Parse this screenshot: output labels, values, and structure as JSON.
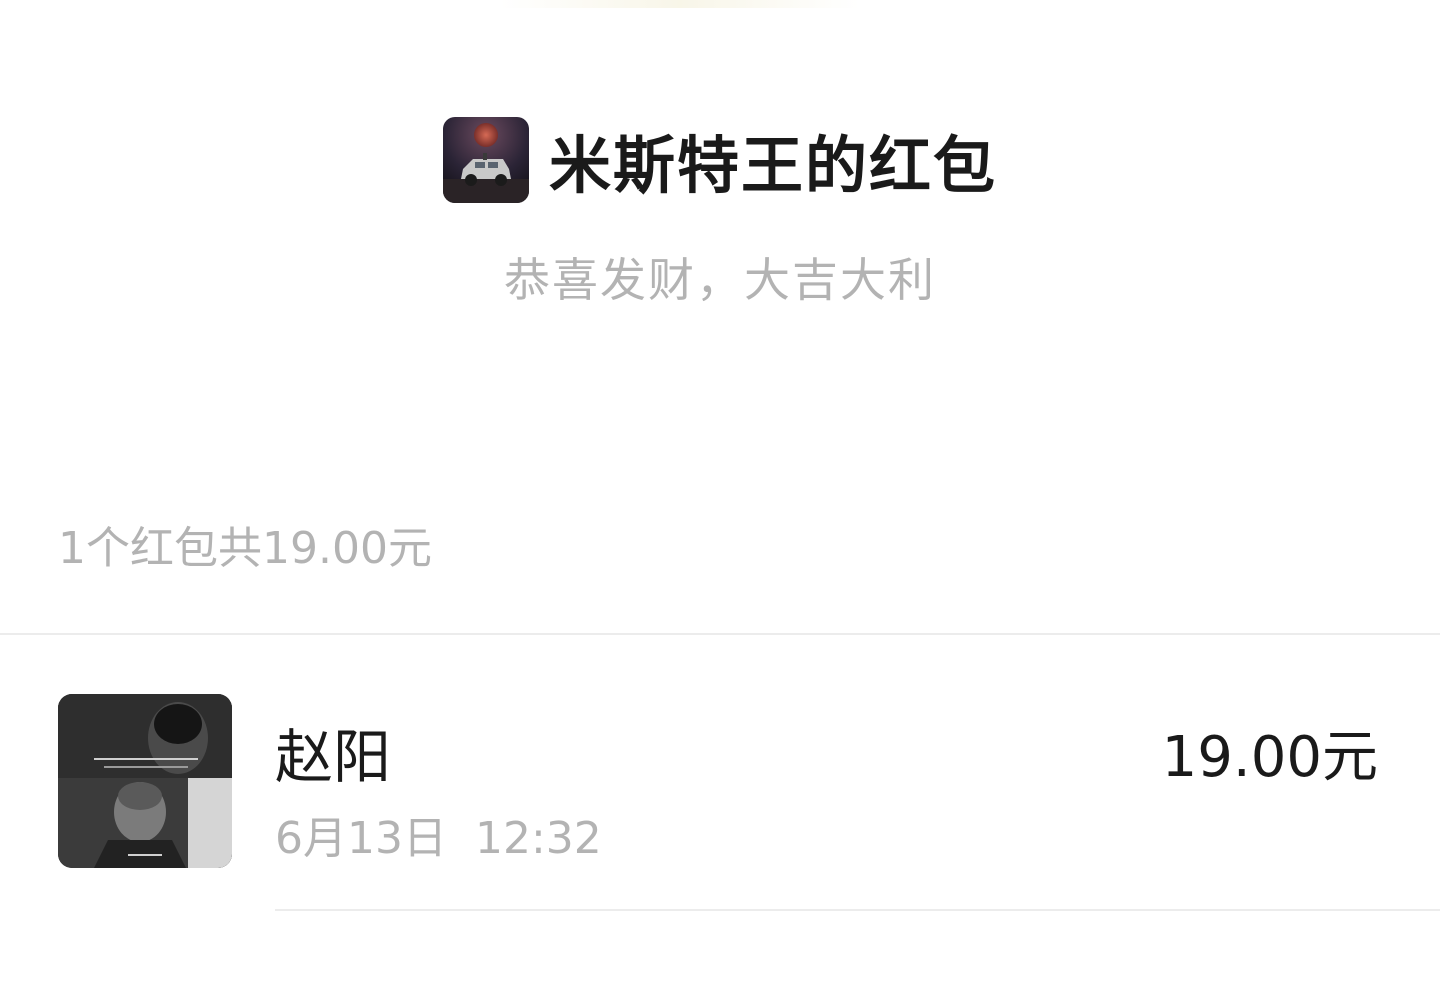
{
  "sender": {
    "title": "米斯特王的红包",
    "avatar_icon": "night-jeep-avatar"
  },
  "blessing": "恭喜发财，大吉大利",
  "summary": "1个红包共19.00元",
  "records": [
    {
      "name": "赵阳",
      "time": "6月13日  12:32",
      "amount": "19.00元",
      "avatar_icon": "film-still-avatar"
    }
  ],
  "colors": {
    "primary_text": "#1a1a1a",
    "secondary_text": "#b3b3b3",
    "divider": "#ececec",
    "background": "#ffffff"
  }
}
